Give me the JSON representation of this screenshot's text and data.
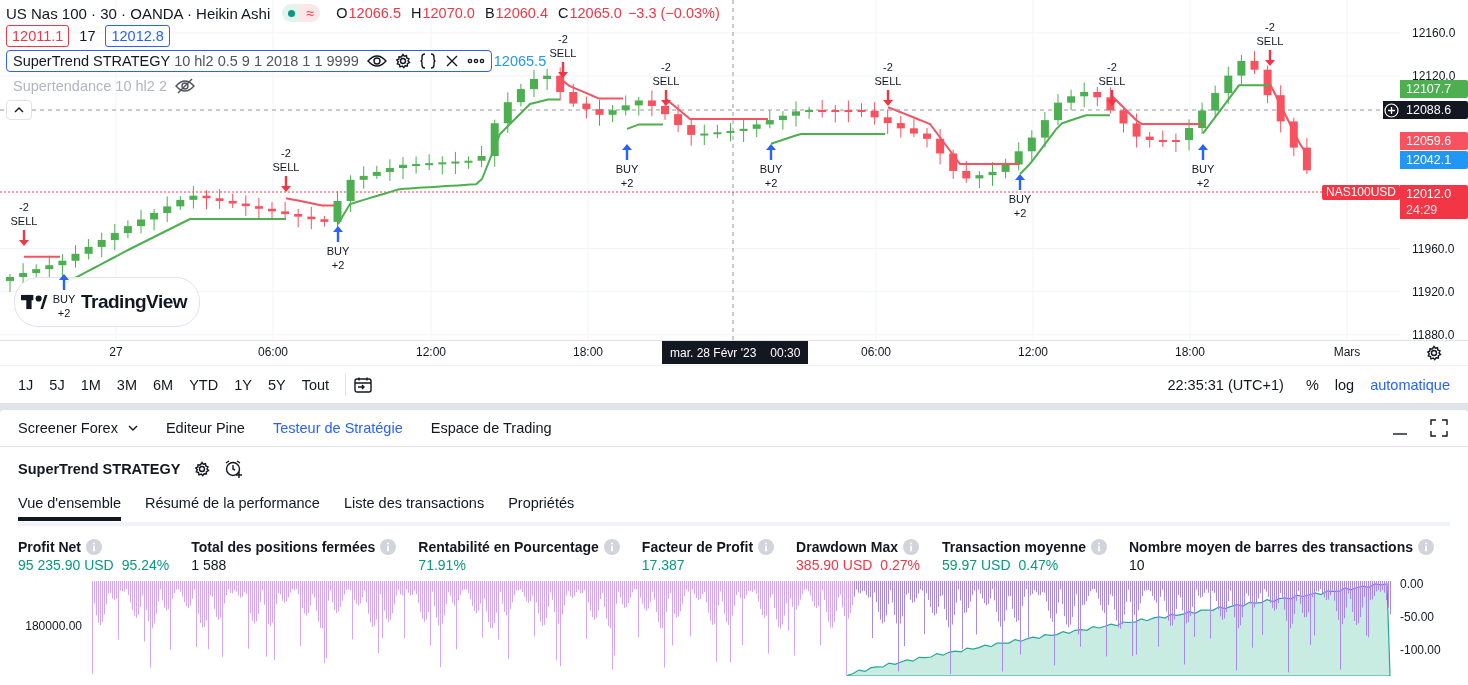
{
  "header": {
    "symbol": "US Nas 100 · 30 · OANDA · Heikin Ashi",
    "market_open": true,
    "data_flag": "≈",
    "ohlc": [
      {
        "key": "O",
        "value": "12066.5"
      },
      {
        "key": "H",
        "value": "12070.0"
      },
      {
        "key": "B",
        "value": "12060.4"
      },
      {
        "key": "C",
        "value": "12065.0"
      }
    ],
    "change": "−3.3 (−0.03%)"
  },
  "quote": {
    "bid": "12011.1",
    "spread": "17",
    "ask": "12012.8"
  },
  "indicators": [
    {
      "name": "SuperTrend STRATEGY",
      "params": "10 hl2 0.5 9 1 2018 1 1 9999",
      "selected": true,
      "hidden": false,
      "value": "12065.5"
    },
    {
      "name": "Supertendance",
      "params": "10 hl2 2",
      "selected": false,
      "hidden": true
    }
  ],
  "chart": {
    "signals": [
      {
        "kind": "sell",
        "amount": "-2",
        "label": "SELL"
      },
      {
        "kind": "buy",
        "amount": "+2",
        "label": "BUY"
      },
      {
        "kind": "sell",
        "amount": "-2",
        "label": "SELL"
      },
      {
        "kind": "buy",
        "amount": "+2",
        "label": "BUY"
      },
      {
        "kind": "sell",
        "amount": "-2",
        "label": "SELL"
      },
      {
        "kind": "buy",
        "amount": "+2",
        "label": "BUY"
      },
      {
        "kind": "sell",
        "amount": "-2",
        "label": "SELL"
      },
      {
        "kind": "buy",
        "amount": "+2",
        "label": "BUY"
      },
      {
        "kind": "sell",
        "amount": "-2",
        "label": "SELL"
      },
      {
        "kind": "buy",
        "amount": "+2",
        "label": "BUY"
      },
      {
        "kind": "sell",
        "amount": "-2",
        "label": "SELL"
      },
      {
        "kind": "buy",
        "amount": "+2",
        "label": "BUY"
      },
      {
        "kind": "sell",
        "amount": "-2",
        "label": "SELL"
      }
    ],
    "brand": "TradingView",
    "symbol_tag": "NAS100USD",
    "price_ticks": [
      "12160.0",
      "12120.0",
      "11960.0",
      "11920.0",
      "11880.0"
    ],
    "price_tags": [
      {
        "kind": "level",
        "value": "12107.7",
        "color": "#4caf50"
      },
      {
        "kind": "crosshair",
        "value": "12088.6",
        "color": "#131722"
      },
      {
        "kind": "level",
        "value": "12059.6",
        "color": "#f7525f"
      },
      {
        "kind": "level",
        "value": "12042.1",
        "color": "#2196f3"
      },
      {
        "kind": "last",
        "value": "12012.0",
        "countdown": "24:29",
        "color": "#f23645"
      }
    ],
    "time_ticks": [
      "27",
      "06:00",
      "12:00",
      "18:00",
      "06:00",
      "12:00",
      "18:00",
      "Mars"
    ],
    "crosshair_date": "mar. 28 Févr '23",
    "crosshair_time": "00:30"
  },
  "ranges": [
    "1J",
    "5J",
    "1M",
    "3M",
    "6M",
    "YTD",
    "1Y",
    "5Y",
    "Tout"
  ],
  "clock": "22:35:31 (UTC+1)",
  "scale_options": [
    {
      "label": "%",
      "selected": false
    },
    {
      "label": "log",
      "selected": false
    },
    {
      "label": "automatique",
      "selected": true
    }
  ],
  "panel_tabs": [
    {
      "label": "Screener Forex",
      "selected": false,
      "dropdown": true
    },
    {
      "label": "Editeur Pine",
      "selected": false,
      "dropdown": false
    },
    {
      "label": "Testeur de Stratégie",
      "selected": true,
      "dropdown": false
    },
    {
      "label": "Espace de Trading",
      "selected": false,
      "dropdown": false
    }
  ],
  "strategy": {
    "title": "SuperTrend STRATEGY"
  },
  "strategy_tabs": [
    {
      "label": "Vue d'ensemble",
      "selected": true
    },
    {
      "label": "Résumé de la performance",
      "selected": false
    },
    {
      "label": "Liste des transactions",
      "selected": false
    },
    {
      "label": "Propriétés",
      "selected": false
    }
  ],
  "metrics": [
    {
      "label": "Profit Net",
      "values": [
        {
          "text": "95 235.90 USD",
          "color": "#089981"
        },
        {
          "text": "95.24%",
          "color": "#089981"
        }
      ]
    },
    {
      "label": "Total des positions fermées",
      "values": [
        {
          "text": "1 588",
          "color": "#131722"
        }
      ]
    },
    {
      "label": "Rentabilité en Pourcentage",
      "values": [
        {
          "text": "71.91%",
          "color": "#089981"
        }
      ]
    },
    {
      "label": "Facteur de Profit",
      "values": [
        {
          "text": "17.387",
          "color": "#089981"
        }
      ]
    },
    {
      "label": "Drawdown Max",
      "values": [
        {
          "text": "385.90 USD",
          "color": "#f23645"
        },
        {
          "text": "0.27%",
          "color": "#f23645"
        }
      ]
    },
    {
      "label": "Transaction moyenne",
      "values": [
        {
          "text": "59.97 USD",
          "color": "#089981"
        },
        {
          "text": "0.47%",
          "color": "#089981"
        }
      ]
    },
    {
      "label": "Nombre moyen de barres des transactions",
      "values": [
        {
          "text": "10",
          "color": "#131722"
        }
      ]
    }
  ],
  "equity_chart": {
    "left_label": "180000.00",
    "right_ticks": [
      "0.00",
      "-50.00",
      "-100.00"
    ]
  }
}
